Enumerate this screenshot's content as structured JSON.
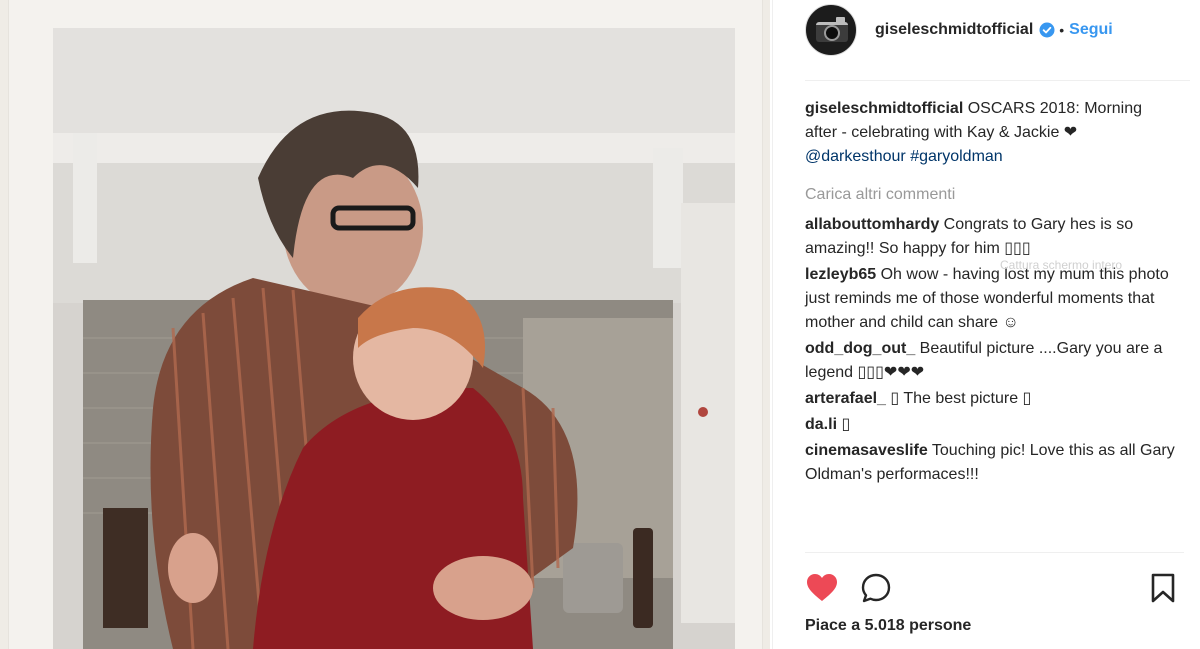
{
  "post": {
    "author": "giseleschmidtofficial",
    "follow_label": "Segui",
    "separator": "•",
    "colors": {
      "accent": "#3897f0",
      "heart": "#ed4956",
      "text": "#262626",
      "muted": "#999999",
      "link": "#003569"
    }
  },
  "caption": {
    "username": "giseleschmidtofficial",
    "text_before": " OSCARS 2018: Morning after - celebrating with Kay & Jackie ❤ ",
    "mention": "@darkesthour",
    "space": " ",
    "hashtag": "#garyoldman"
  },
  "load_more": "Carica altri commenti",
  "comments": [
    {
      "username": "allabouttomhardy",
      "text": " Congrats to Gary hes is so amazing!! So happy for him ▯▯▯"
    },
    {
      "username": "lezleyb65",
      "text": " Oh wow - having lost my mum this photo just reminds me of those wonderful moments that mother and child can share ☺"
    },
    {
      "username": "odd_dog_out_",
      "text": " Beautiful picture ....Gary you are a legend ▯▯▯❤❤❤"
    },
    {
      "username": "arterafael_",
      "text": " ▯ The best picture ▯"
    },
    {
      "username": "da.li",
      "text": " ▯"
    },
    {
      "username": "cinemasaveslife",
      "text": " Touching pic! Love this as all Gary Oldman's performaces!!!"
    }
  ],
  "overlay_text": "Cattura schermo intero",
  "likes_label": "Piace a 5.018 persone",
  "icons": {
    "like": "heart-icon",
    "comment": "comment-icon",
    "save": "bookmark-icon",
    "verified": "verified-badge-icon"
  }
}
